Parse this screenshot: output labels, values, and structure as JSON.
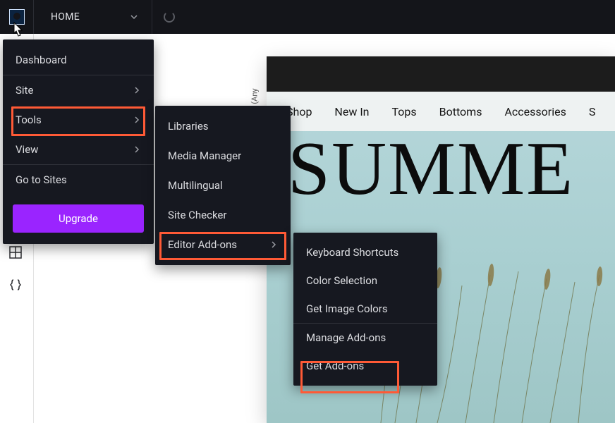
{
  "topbar": {
    "home_label": "HOME"
  },
  "menu1": {
    "dashboard": "Dashboard",
    "site": "Site",
    "tools": "Tools",
    "view": "View",
    "go_to_sites": "Go to Sites",
    "upgrade": "Upgrade"
  },
  "menu2": {
    "libraries": "Libraries",
    "media_manager": "Media Manager",
    "multilingual": "Multilingual",
    "site_checker": "Site Checker",
    "editor_addons": "Editor Add-ons"
  },
  "menu3": {
    "keyboard_shortcuts": "Keyboard Shortcuts",
    "color_selection": "Color Selection",
    "get_image_colors": "Get Image Colors",
    "manage_addons": "Manage Add-ons",
    "get_addons": "Get Add-ons"
  },
  "canvas": {
    "nav": {
      "shop": "Shop",
      "new_in": "New In",
      "tops": "Tops",
      "bottoms": "Bottoms",
      "accessories": "Accessories",
      "more": "S"
    },
    "headline": "SUMME",
    "side_label": "(Any"
  },
  "colors": {
    "highlight": "#ff5a36",
    "upgrade": "#9a24ff"
  }
}
